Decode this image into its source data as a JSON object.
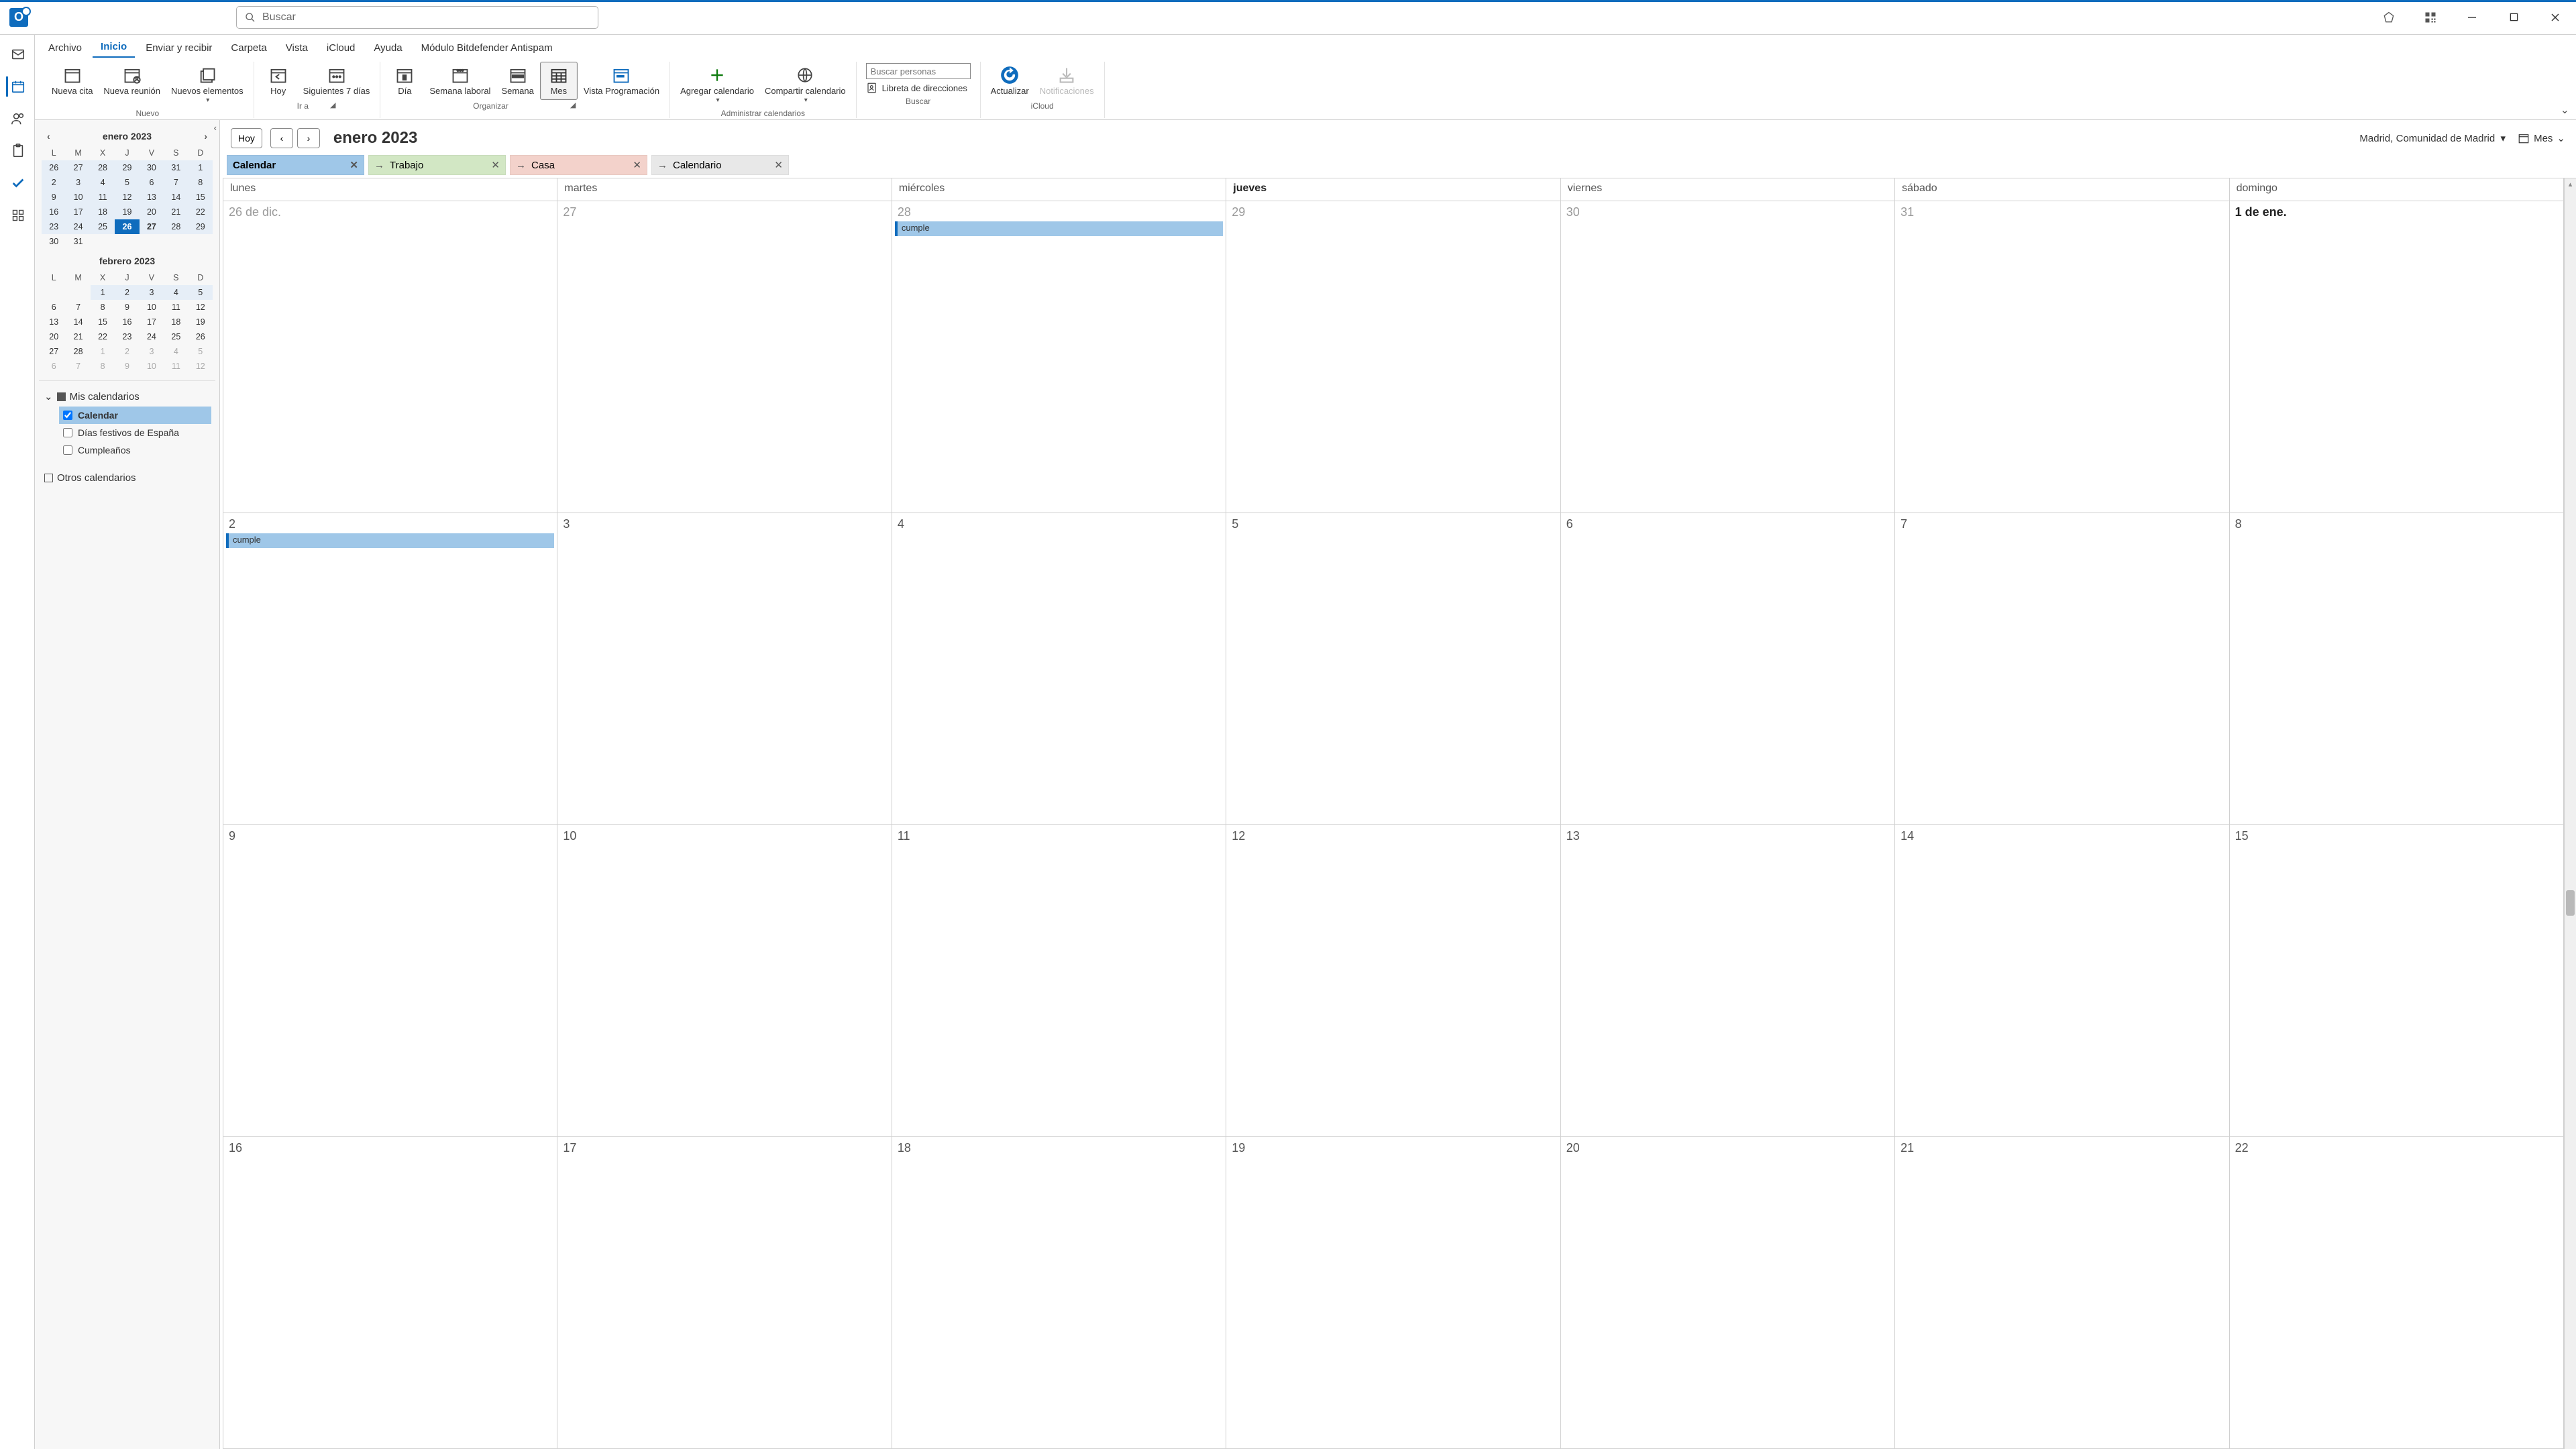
{
  "search_placeholder": "Buscar",
  "menubar": [
    "Archivo",
    "Inicio",
    "Enviar y recibir",
    "Carpeta",
    "Vista",
    "iCloud",
    "Ayuda",
    "Módulo Bitdefender Antispam"
  ],
  "menubar_active": 1,
  "ribbon": {
    "nuevo": {
      "label": "Nuevo",
      "cita": "Nueva cita",
      "reunion": "Nueva reunión",
      "elementos": "Nuevos elementos"
    },
    "ira": {
      "label": "Ir a",
      "hoy": "Hoy",
      "sig7": "Siguientes 7 días"
    },
    "organizar": {
      "label": "Organizar",
      "dia": "Día",
      "semlab": "Semana laboral",
      "semana": "Semana",
      "mes": "Mes",
      "vistaprog": "Vista Programación"
    },
    "admin": {
      "label": "Administrar calendarios",
      "agregar": "Agregar calendario",
      "compartir": "Compartir calendario"
    },
    "buscar": {
      "label": "Buscar",
      "people_ph": "Buscar personas",
      "libreta": "Libreta de direcciones"
    },
    "icloud": {
      "label": "iCloud",
      "actualizar": "Actualizar",
      "notif": "Notificaciones"
    }
  },
  "calendar_header": {
    "hoy": "Hoy",
    "title": "enero 2023",
    "location": "Madrid, Comunidad de Madrid",
    "view": "Mes"
  },
  "tabs": [
    {
      "label": "Calendar",
      "color": "blue"
    },
    {
      "label": "Trabajo",
      "color": "green"
    },
    {
      "label": "Casa",
      "color": "red"
    },
    {
      "label": "Calendario",
      "color": "gray"
    }
  ],
  "day_headers": [
    "lunes",
    "martes",
    "miércoles",
    "jueves",
    "viernes",
    "sábado",
    "domingo"
  ],
  "today_col": 3,
  "weeks": [
    [
      {
        "label": "26 de dic.",
        "dim": true
      },
      {
        "label": "27",
        "dim": true
      },
      {
        "label": "28",
        "dim": true,
        "event": "cumple"
      },
      {
        "label": "29",
        "dim": true
      },
      {
        "label": "30",
        "dim": true
      },
      {
        "label": "31",
        "dim": true
      },
      {
        "label": "1 de ene.",
        "bold": true
      }
    ],
    [
      {
        "label": "2",
        "event": "cumple"
      },
      {
        "label": "3"
      },
      {
        "label": "4"
      },
      {
        "label": "5"
      },
      {
        "label": "6"
      },
      {
        "label": "7"
      },
      {
        "label": "8"
      }
    ],
    [
      {
        "label": "9"
      },
      {
        "label": "10"
      },
      {
        "label": "11"
      },
      {
        "label": "12"
      },
      {
        "label": "13"
      },
      {
        "label": "14"
      },
      {
        "label": "15"
      }
    ],
    [
      {
        "label": "16"
      },
      {
        "label": "17"
      },
      {
        "label": "18"
      },
      {
        "label": "19"
      },
      {
        "label": "20"
      },
      {
        "label": "21"
      },
      {
        "label": "22"
      }
    ]
  ],
  "minical": {
    "month1": "enero 2023",
    "month2": "febrero 2023",
    "dh": [
      "L",
      "M",
      "X",
      "J",
      "V",
      "S",
      "D"
    ],
    "m1": [
      [
        {
          "n": 26,
          "r": true
        },
        {
          "n": 27,
          "r": true
        },
        {
          "n": 28,
          "r": true
        },
        {
          "n": 29,
          "r": true
        },
        {
          "n": 30,
          "r": true
        },
        {
          "n": 31,
          "r": true
        },
        {
          "n": 1,
          "r": true
        }
      ],
      [
        {
          "n": 2,
          "r": true
        },
        {
          "n": 3,
          "r": true
        },
        {
          "n": 4,
          "r": true
        },
        {
          "n": 5,
          "r": true
        },
        {
          "n": 6,
          "r": true
        },
        {
          "n": 7,
          "r": true
        },
        {
          "n": 8,
          "r": true
        }
      ],
      [
        {
          "n": 9,
          "r": true
        },
        {
          "n": 10,
          "r": true
        },
        {
          "n": 11,
          "r": true
        },
        {
          "n": 12,
          "r": true
        },
        {
          "n": 13,
          "r": true
        },
        {
          "n": 14,
          "r": true
        },
        {
          "n": 15,
          "r": true
        }
      ],
      [
        {
          "n": 16,
          "r": true
        },
        {
          "n": 17,
          "r": true
        },
        {
          "n": 18,
          "r": true
        },
        {
          "n": 19,
          "r": true
        },
        {
          "n": 20,
          "r": true
        },
        {
          "n": 21,
          "r": true
        },
        {
          "n": 22,
          "r": true
        }
      ],
      [
        {
          "n": 23,
          "r": true
        },
        {
          "n": 24,
          "r": true
        },
        {
          "n": 25,
          "r": true
        },
        {
          "n": 26,
          "r": true,
          "today": true
        },
        {
          "n": 27,
          "r": true,
          "bold": true
        },
        {
          "n": 28,
          "r": true
        },
        {
          "n": 29,
          "r": true
        }
      ],
      [
        {
          "n": 30
        },
        {
          "n": 31
        },
        {
          "n": "",
          "e": true
        },
        {
          "n": "",
          "e": true
        },
        {
          "n": "",
          "e": true
        },
        {
          "n": "",
          "e": true
        },
        {
          "n": "",
          "e": true
        }
      ]
    ],
    "m2": [
      [
        {
          "n": "",
          "e": true
        },
        {
          "n": "",
          "e": true
        },
        {
          "n": 1,
          "r": true
        },
        {
          "n": 2,
          "r": true
        },
        {
          "n": 3,
          "r": true
        },
        {
          "n": 4,
          "r": true
        },
        {
          "n": 5,
          "r": true
        }
      ],
      [
        {
          "n": 6
        },
        {
          "n": 7
        },
        {
          "n": 8
        },
        {
          "n": 9
        },
        {
          "n": 10
        },
        {
          "n": 11
        },
        {
          "n": 12
        }
      ],
      [
        {
          "n": 13
        },
        {
          "n": 14
        },
        {
          "n": 15
        },
        {
          "n": 16
        },
        {
          "n": 17
        },
        {
          "n": 18
        },
        {
          "n": 19
        }
      ],
      [
        {
          "n": 20
        },
        {
          "n": 21
        },
        {
          "n": 22
        },
        {
          "n": 23
        },
        {
          "n": 24
        },
        {
          "n": 25
        },
        {
          "n": 26
        }
      ],
      [
        {
          "n": 27
        },
        {
          "n": 28
        },
        {
          "n": 1,
          "dim": true
        },
        {
          "n": 2,
          "dim": true
        },
        {
          "n": 3,
          "dim": true
        },
        {
          "n": 4,
          "dim": true
        },
        {
          "n": 5,
          "dim": true
        }
      ],
      [
        {
          "n": 6,
          "dim": true
        },
        {
          "n": 7,
          "dim": true
        },
        {
          "n": 8,
          "dim": true
        },
        {
          "n": 9,
          "dim": true
        },
        {
          "n": 10,
          "dim": true
        },
        {
          "n": 11,
          "dim": true
        },
        {
          "n": 12,
          "dim": true
        }
      ]
    ]
  },
  "nav": {
    "section1": "Mis calendarios",
    "items": [
      {
        "label": "Calendar",
        "checked": true,
        "selected": true
      },
      {
        "label": "Días festivos de España",
        "checked": false
      },
      {
        "label": "Cumpleaños",
        "checked": false
      }
    ],
    "section2": "Otros calendarios"
  }
}
